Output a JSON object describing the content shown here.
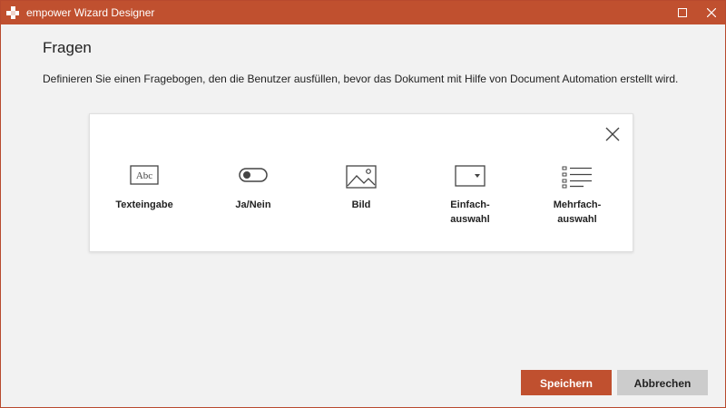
{
  "window": {
    "title": "empower Wizard Designer"
  },
  "header": {
    "title": "Fragen",
    "description": "Definieren Sie einen Fragebogen, den die Benutzer ausfüllen, bevor das Dokument mit Hilfe von Document Automation erstellt wird."
  },
  "question_types": [
    {
      "label": "Texteingabe",
      "icon": "text-input-icon"
    },
    {
      "label": "Ja/Nein",
      "icon": "toggle-icon"
    },
    {
      "label": "Bild",
      "icon": "image-icon"
    },
    {
      "label": "Einfach-\nauswahl",
      "icon": "dropdown-icon"
    },
    {
      "label": "Mehrfach-\nauswahl",
      "icon": "checklist-icon"
    }
  ],
  "icons": {
    "abc_text": "Abc"
  },
  "buttons": {
    "save": "Speichern",
    "cancel": "Abbrechen"
  },
  "colors": {
    "accent": "#c0502f",
    "cancel_bg": "#cccccc",
    "background": "#f2f2f2"
  }
}
